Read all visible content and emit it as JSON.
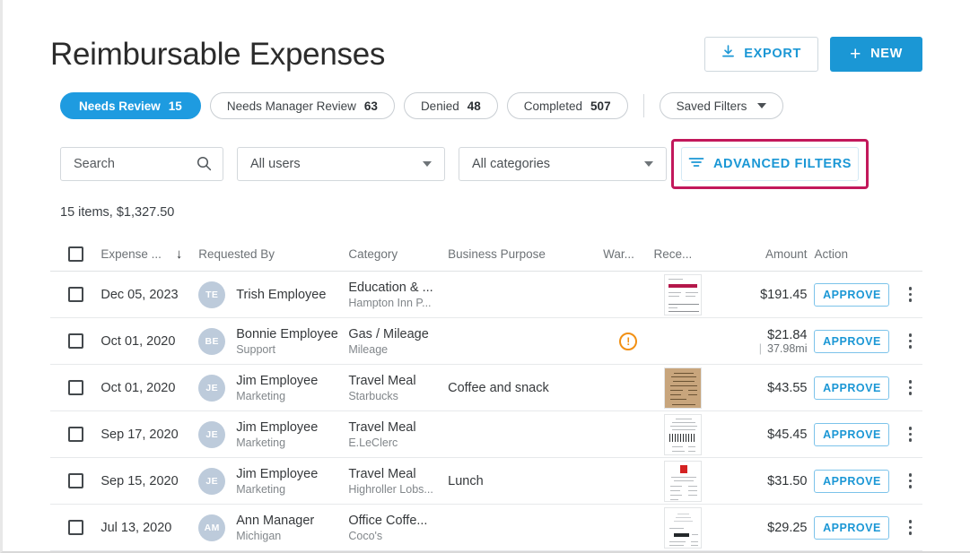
{
  "header": {
    "title": "Reimbursable Expenses",
    "export_label": "EXPORT",
    "new_label": "NEW",
    "plus_glyph": "+"
  },
  "chips": [
    {
      "label": "Needs Review",
      "count": "15",
      "active": true
    },
    {
      "label": "Needs Manager Review",
      "count": "63",
      "active": false
    },
    {
      "label": "Denied",
      "count": "48",
      "active": false
    },
    {
      "label": "Completed",
      "count": "507",
      "active": false
    }
  ],
  "saved_filters": {
    "label": "Saved Filters"
  },
  "filters": {
    "search_placeholder": "Search",
    "users_select": "All users",
    "categories_select": "All categories",
    "advanced_label": "ADVANCED FILTERS",
    "highlight_color": "#c2185b"
  },
  "summary": "15 items, $1,327.50",
  "table": {
    "columns": [
      "Expense ...",
      "Requested By",
      "Category",
      "Business Purpose",
      "War...",
      "Rece...",
      "Amount",
      "Action"
    ],
    "sort_indicator": "↓",
    "approve_label": "APPROVE",
    "rows": [
      {
        "date": "Dec 05, 2023",
        "initials": "TE",
        "requester": "Trish Employee",
        "department": "",
        "category": "Education & ...",
        "merchant": "Hampton Inn P...",
        "purpose": "",
        "warning": false,
        "receipt": "white-red-band",
        "amount": "$191.45",
        "amount_sub": ""
      },
      {
        "date": "Oct 01, 2020",
        "initials": "BE",
        "requester": "Bonnie Employee",
        "department": "Support",
        "category": "Gas / Mileage",
        "merchant": "Mileage",
        "purpose": "",
        "warning": true,
        "receipt": "none",
        "amount": "$21.84",
        "amount_sub": "37.98mi"
      },
      {
        "date": "Oct 01, 2020",
        "initials": "JE",
        "requester": "Jim Employee",
        "department": "Marketing",
        "category": "Travel Meal",
        "merchant": "Starbucks",
        "purpose": "Coffee and snack",
        "warning": false,
        "receipt": "tan",
        "amount": "$43.55",
        "amount_sub": ""
      },
      {
        "date": "Sep 17, 2020",
        "initials": "JE",
        "requester": "Jim Employee",
        "department": "Marketing",
        "category": "Travel Meal",
        "merchant": "E.LeClerc",
        "purpose": "",
        "warning": false,
        "receipt": "barcode",
        "amount": "$45.45",
        "amount_sub": ""
      },
      {
        "date": "Sep 15, 2020",
        "initials": "JE",
        "requester": "Jim Employee",
        "department": "Marketing",
        "category": "Travel Meal",
        "merchant": "Highroller Lobs...",
        "purpose": "Lunch",
        "warning": false,
        "receipt": "red-logo",
        "amount": "$31.50",
        "amount_sub": ""
      },
      {
        "date": "Jul 13, 2020",
        "initials": "AM",
        "requester": "Ann Manager",
        "department": "Michigan",
        "category": "Office Coffe...",
        "merchant": "Coco's",
        "purpose": "",
        "warning": false,
        "receipt": "faded",
        "amount": "$29.25",
        "amount_sub": ""
      }
    ]
  },
  "colors": {
    "accent": "#1b97d5",
    "chip_active": "#1e9be0",
    "warning": "#f29013"
  }
}
